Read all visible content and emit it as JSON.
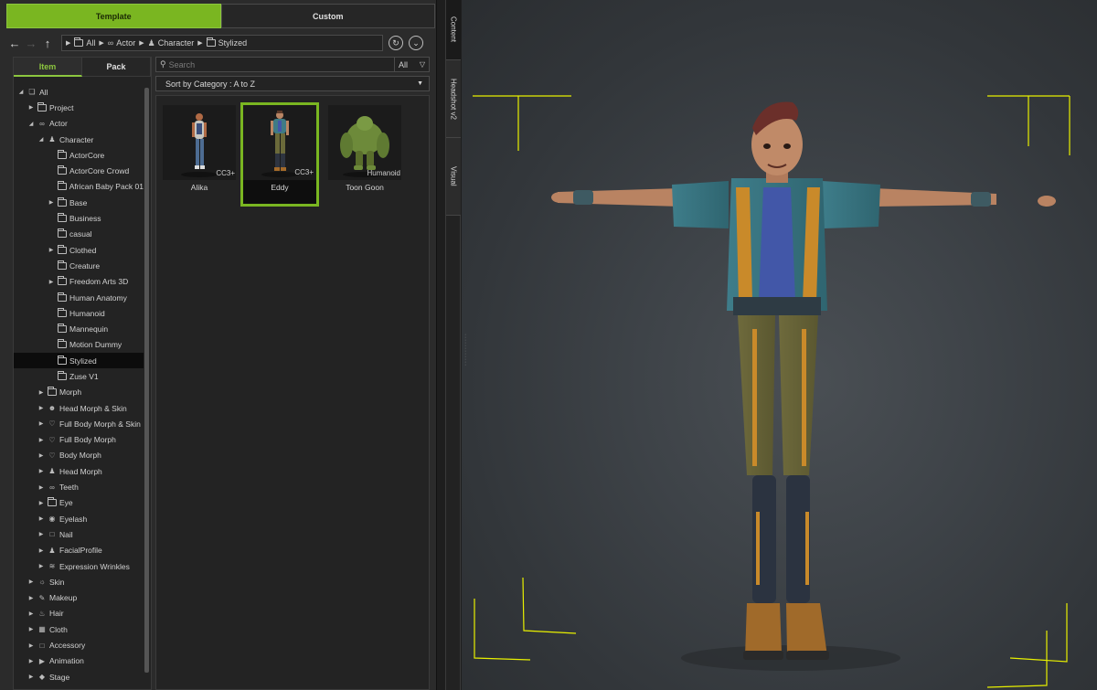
{
  "tabs": {
    "template": "Template",
    "custom": "Custom"
  },
  "breadcrumb": [
    "All",
    "Actor",
    "Character",
    "Stylized"
  ],
  "subtabs": {
    "item": "Item",
    "pack": "Pack"
  },
  "search": {
    "placeholder": "Search",
    "filter_label": "All"
  },
  "sort": {
    "label": "Sort by Category : A to Z"
  },
  "side_tabs": [
    "Content",
    "Headshot v2",
    "Visual"
  ],
  "tree": [
    {
      "label": "All",
      "depth": 0,
      "expander": "open",
      "icon": "all-icon"
    },
    {
      "label": "Project",
      "depth": 1,
      "expander": "closed",
      "icon": "folder-icon"
    },
    {
      "label": "Actor",
      "depth": 1,
      "expander": "open",
      "icon": "actor-icon"
    },
    {
      "label": "Character",
      "depth": 2,
      "expander": "open",
      "icon": "character-icon"
    },
    {
      "label": "ActorCore",
      "depth": 3,
      "expander": "none",
      "icon": "folder-icon"
    },
    {
      "label": "ActorCore Crowd",
      "depth": 3,
      "expander": "none",
      "icon": "folder-icon"
    },
    {
      "label": "African Baby Pack 01",
      "depth": 3,
      "expander": "none",
      "icon": "folder-icon"
    },
    {
      "label": "Base",
      "depth": 3,
      "expander": "closed",
      "icon": "folder-icon"
    },
    {
      "label": "Business",
      "depth": 3,
      "expander": "none",
      "icon": "folder-icon"
    },
    {
      "label": "casual",
      "depth": 3,
      "expander": "none",
      "icon": "folder-icon"
    },
    {
      "label": "Clothed",
      "depth": 3,
      "expander": "closed",
      "icon": "folder-icon"
    },
    {
      "label": "Creature",
      "depth": 3,
      "expander": "none",
      "icon": "folder-icon"
    },
    {
      "label": "Freedom Arts 3D",
      "depth": 3,
      "expander": "closed",
      "icon": "folder-icon"
    },
    {
      "label": "Human Anatomy",
      "depth": 3,
      "expander": "none",
      "icon": "folder-icon"
    },
    {
      "label": "Humanoid",
      "depth": 3,
      "expander": "none",
      "icon": "folder-icon"
    },
    {
      "label": "Mannequin",
      "depth": 3,
      "expander": "none",
      "icon": "folder-icon"
    },
    {
      "label": "Motion Dummy",
      "depth": 3,
      "expander": "none",
      "icon": "folder-icon"
    },
    {
      "label": "Stylized",
      "depth": 3,
      "expander": "none",
      "icon": "folder-icon",
      "selected": true
    },
    {
      "label": "Zuse V1",
      "depth": 3,
      "expander": "none",
      "icon": "folder-icon"
    },
    {
      "label": "Morph",
      "depth": 2,
      "expander": "closed",
      "icon": "folder-icon"
    },
    {
      "label": "Head Morph & Skin",
      "depth": 2,
      "expander": "closed",
      "icon": "head-morph-icon"
    },
    {
      "label": "Full Body Morph & Skin",
      "depth": 2,
      "expander": "closed",
      "icon": "body-morph-icon"
    },
    {
      "label": "Full Body Morph",
      "depth": 2,
      "expander": "closed",
      "icon": "body-icon"
    },
    {
      "label": "Body Morph",
      "depth": 2,
      "expander": "closed",
      "icon": "body-icon"
    },
    {
      "label": "Head Morph",
      "depth": 2,
      "expander": "closed",
      "icon": "head-icon"
    },
    {
      "label": "Teeth",
      "depth": 2,
      "expander": "closed",
      "icon": "teeth-icon"
    },
    {
      "label": "Eye",
      "depth": 2,
      "expander": "closed",
      "icon": "folder-icon"
    },
    {
      "label": "Eyelash",
      "depth": 2,
      "expander": "closed",
      "icon": "eyelash-icon"
    },
    {
      "label": "Nail",
      "depth": 2,
      "expander": "closed",
      "icon": "nail-icon"
    },
    {
      "label": "FacialProfile",
      "depth": 2,
      "expander": "closed",
      "icon": "facial-profile-icon"
    },
    {
      "label": "Expression Wrinkles",
      "depth": 2,
      "expander": "closed",
      "icon": "wrinkles-icon"
    },
    {
      "label": "Skin",
      "depth": 1,
      "expander": "closed",
      "icon": "skin-icon"
    },
    {
      "label": "Makeup",
      "depth": 1,
      "expander": "closed",
      "icon": "makeup-icon"
    },
    {
      "label": "Hair",
      "depth": 1,
      "expander": "closed",
      "icon": "hair-icon"
    },
    {
      "label": "Cloth",
      "depth": 1,
      "expander": "closed",
      "icon": "cloth-icon"
    },
    {
      "label": "Accessory",
      "depth": 1,
      "expander": "closed",
      "icon": "accessory-icon"
    },
    {
      "label": "Animation",
      "depth": 1,
      "expander": "closed",
      "icon": "animation-icon"
    },
    {
      "label": "Stage",
      "depth": 1,
      "expander": "closed",
      "icon": "stage-icon"
    }
  ],
  "items": [
    {
      "label": "Alika",
      "badge": "CC3+",
      "selected": false
    },
    {
      "label": "Eddy",
      "badge": "CC3+",
      "selected": true
    },
    {
      "label": "Toon Goon",
      "badge": "Humanoid",
      "selected": false
    }
  ],
  "colors": {
    "accent": "#7ab621",
    "selection_box": "#e8f000",
    "panel": "#2b2b2b"
  }
}
